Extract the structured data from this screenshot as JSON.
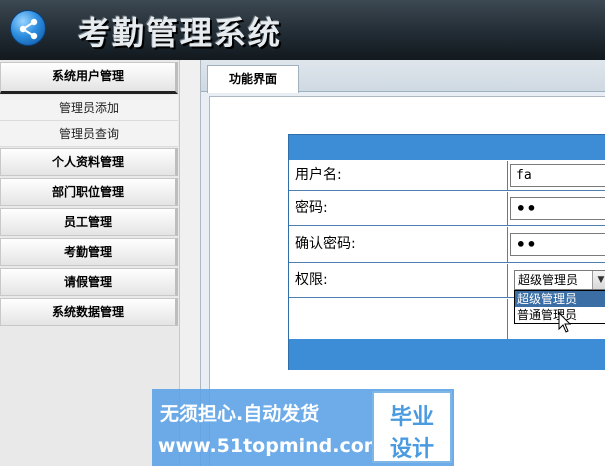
{
  "header": {
    "app_title": "考勤管理系统",
    "logo_icon": "share-icon"
  },
  "sidebar": {
    "groups": [
      {
        "label": "系统用户管理",
        "children": [
          "管理员添加",
          "管理员查询"
        ]
      },
      {
        "label": "个人资料管理"
      },
      {
        "label": "部门职位管理"
      },
      {
        "label": "员工管理"
      },
      {
        "label": "考勤管理"
      },
      {
        "label": "请假管理"
      },
      {
        "label": "系统数据管理"
      }
    ]
  },
  "main": {
    "tab_label": "功能界面",
    "form": {
      "username": {
        "label": "用户名:",
        "value": "fa"
      },
      "password": {
        "label": "密码:",
        "value": "••"
      },
      "confirm_password": {
        "label": "确认密码:",
        "value": "••"
      },
      "role": {
        "label": "权限:",
        "selected": "超级管理员",
        "options": [
          "超级管理员",
          "普通管理员"
        ]
      }
    }
  },
  "watermark": {
    "line1": "无须担心.自动发货",
    "line2": "www.51topmind.com",
    "stamp_top": "毕业",
    "stamp_bottom": "设计"
  },
  "colors": {
    "accent_blue": "#3c8cd6",
    "header_dark": "#222c34"
  }
}
